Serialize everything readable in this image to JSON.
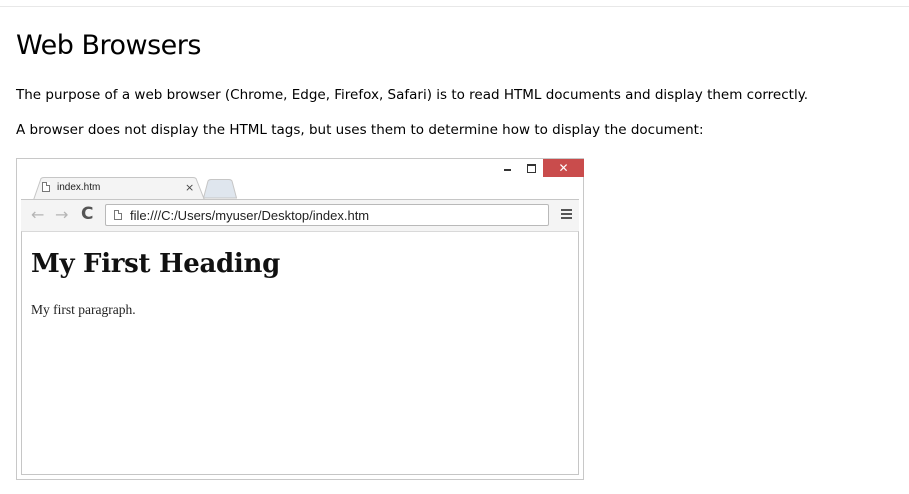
{
  "page": {
    "title": "Web Browsers",
    "paragraphs": [
      "The purpose of a web browser (Chrome, Edge, Firefox, Safari) is to read HTML documents and display them correctly.",
      "A browser does not display the HTML tags, but uses them to determine how to display the document:"
    ]
  },
  "browser": {
    "tab": {
      "label": "index.htm",
      "close_glyph": "×"
    },
    "window_controls": {
      "close_glyph": "✕"
    },
    "address_bar": {
      "url": "file:///C:/Users/myuser/Desktop/index.htm"
    },
    "nav": {
      "back_glyph": "←",
      "forward_glyph": "→",
      "reload_glyph": "C"
    },
    "document": {
      "heading": "My First Heading",
      "paragraph": "My first paragraph."
    },
    "colors": {
      "close_button": "#c94c4c",
      "chrome": "#f4f4f4"
    }
  }
}
